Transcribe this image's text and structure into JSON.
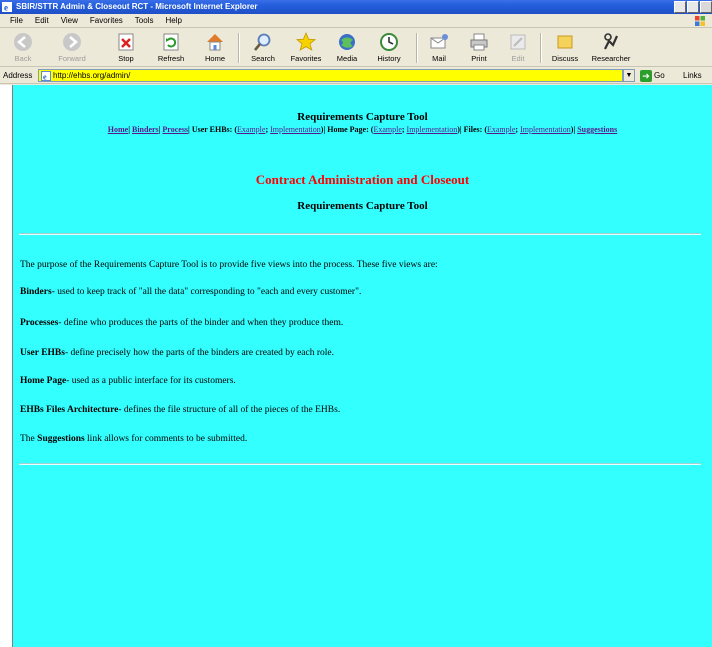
{
  "window": {
    "title": "SBIR/STTR Admin & Closeout RCT - Microsoft Internet Explorer"
  },
  "menubar": {
    "items": [
      "File",
      "Edit",
      "View",
      "Favorites",
      "Tools",
      "Help"
    ]
  },
  "toolbar": {
    "buttons": [
      {
        "label": "Back",
        "icon": "back-arrow-icon",
        "enabled": false
      },
      {
        "label": "Forward",
        "icon": "forward-arrow-icon",
        "enabled": false
      },
      {
        "label": "Stop",
        "icon": "stop-icon",
        "enabled": true
      },
      {
        "label": "Refresh",
        "icon": "refresh-icon",
        "enabled": true
      },
      {
        "label": "Home",
        "icon": "home-icon",
        "enabled": true
      },
      {
        "label": "Search",
        "icon": "search-icon",
        "enabled": true
      },
      {
        "label": "Favorites",
        "icon": "favorites-star-icon",
        "enabled": true
      },
      {
        "label": "Media",
        "icon": "media-icon",
        "enabled": true
      },
      {
        "label": "History",
        "icon": "history-icon",
        "enabled": true
      },
      {
        "label": "Mail",
        "icon": "mail-icon",
        "enabled": true
      },
      {
        "label": "Print",
        "icon": "print-icon",
        "enabled": true
      },
      {
        "label": "Edit",
        "icon": "edit-icon",
        "enabled": false
      },
      {
        "label": "Discuss",
        "icon": "discuss-icon",
        "enabled": true
      },
      {
        "label": "Researcher",
        "icon": "researcher-icon",
        "enabled": true
      }
    ]
  },
  "addressbar": {
    "label": "Address",
    "url": "http://ehbs.org/admin/",
    "go_label": "Go",
    "links_label": "Links"
  },
  "page": {
    "header_title": "Requirements Capture Tool",
    "nav": {
      "home": "Home",
      "binders": "Binders",
      "process": "Process",
      "user_ehbs_label": "User EHBs:",
      "home_page_label": "Home Page:",
      "files_label": "Files:",
      "example": "Example",
      "implementation": "Implementation",
      "suggestions": "Suggestions"
    },
    "contract_title": "Contract Administration and Closeout",
    "subtitle": "Requirements Capture Tool",
    "intro": "The purpose of the Requirements Capture Tool is to provide five views into the process. These five views are:",
    "items": [
      {
        "term": "Binders",
        "text": "- used to keep track of \"all the data\" corresponding to \"each and every customer\"."
      },
      {
        "term": "Processes",
        "text": "- define who produces the parts of the binder and when they produce them."
      },
      {
        "term": "User EHBs",
        "text": "- define precisely how the parts of the binders are created by each role."
      },
      {
        "term": "Home Page",
        "text": "- used as a public interface for its customers."
      },
      {
        "term": "EHBs Files Architecture",
        "text": "- defines the file structure of all of the pieces of the EHBs."
      }
    ],
    "suggestions_note": {
      "prefix": "The ",
      "term": "Suggestions",
      "suffix": " link allows for comments to be submitted."
    }
  },
  "colors": {
    "page_background": "#33ffff",
    "contract_title": "#ff0000",
    "address_field": "#ffff00",
    "link": "#551a8b"
  }
}
